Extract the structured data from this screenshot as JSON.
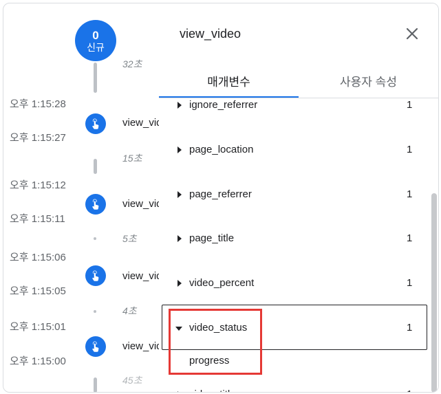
{
  "new_badge": {
    "count": "0",
    "label": "신규"
  },
  "timeline": {
    "durations": [
      "32초",
      "15초",
      "5초",
      "4초",
      "45초"
    ],
    "events": [
      {
        "label": "view_video",
        "time_before": "오후 1:15:28",
        "time_after": "오후 1:15:27"
      },
      {
        "label": "view_video",
        "time_before": "오후 1:15:12",
        "time_after": "오후 1:15:11"
      },
      {
        "label": "view_video",
        "time_before": "오후 1:15:06",
        "time_after": "오후 1:15:05"
      },
      {
        "label": "view_video",
        "time_before": "오후 1:15:01",
        "time_after": "오후 1:15:00"
      }
    ]
  },
  "panel": {
    "title": "view_video",
    "tabs": [
      {
        "label": "매개변수",
        "active": true
      },
      {
        "label": "사용자 속성",
        "active": false
      }
    ],
    "params": [
      {
        "name": "ignore_referrer",
        "count": "1"
      },
      {
        "name": "page_location",
        "count": "1"
      },
      {
        "name": "page_referrer",
        "count": "1"
      },
      {
        "name": "page_title",
        "count": "1"
      },
      {
        "name": "video_percent",
        "count": "1"
      },
      {
        "name": "video_status",
        "count": "1",
        "expanded": true,
        "value": "progress"
      },
      {
        "name": "video_title",
        "count": "1"
      }
    ]
  },
  "colors": {
    "accent": "#1a73e8",
    "highlight": "#e53935",
    "line": "#bdc1c6"
  }
}
